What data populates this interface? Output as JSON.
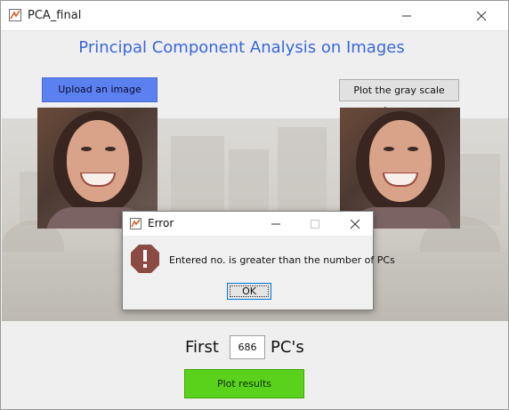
{
  "window": {
    "title": "PCA_final",
    "app_icon": "matlab-figure-icon",
    "controls": [
      "minimize-icon",
      "close-icon"
    ]
  },
  "main": {
    "heading": "Principal Component Analysis on Images",
    "upload_button_label": "Upload an image",
    "plot_gray_button_label": "Plot the gray scale image",
    "first_label": "First",
    "pc_count_value": "686",
    "pcs_label": "PC's",
    "plot_results_label": "Plot results"
  },
  "dialog": {
    "title": "Error",
    "icon": "error-icon",
    "message": "Entered no. is greater than the number of PCs",
    "ok_label": "OK"
  },
  "colors": {
    "heading": "#3a67d8",
    "upload_button": "#5b80ef",
    "plot_results_button": "#5ad21c",
    "error_icon": "#8b4a42"
  }
}
